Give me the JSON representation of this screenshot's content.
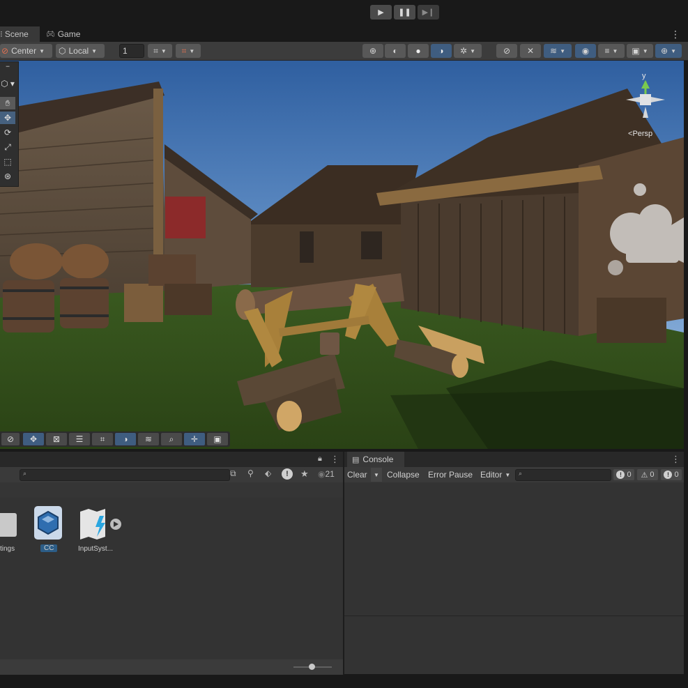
{
  "toolbar_play": {
    "play_icon": "play-icon",
    "pause_icon": "pause-icon",
    "step_icon": "step-icon"
  },
  "tabs": [
    {
      "label": "Scene",
      "icon": "scene-icon",
      "active": true
    },
    {
      "label": "Game",
      "icon": "game-controller-icon",
      "active": false
    }
  ],
  "scene_toolbar": {
    "pivot_mode": "Center",
    "pivot_rotation": "Local",
    "grid_increment": "1"
  },
  "gizmo": {
    "axis_y": "y",
    "projection": "Persp"
  },
  "project": {
    "search_placeholder": "",
    "hidden_count": "21",
    "assets": [
      {
        "label": "tings",
        "icon": "folder-icon"
      },
      {
        "label": "CC",
        "icon": "package-icon",
        "selected": true
      },
      {
        "label": "InputSyst...",
        "icon": "input-actions-icon"
      }
    ]
  },
  "console": {
    "tab_label": "Console",
    "clear": "Clear",
    "collapse": "Collapse",
    "error_pause": "Error Pause",
    "editor": "Editor",
    "log_count": "0",
    "warning_count": "0",
    "error_count": "0"
  },
  "colors": {
    "accent_blue": "#3f5d80",
    "selected_asset": "#2c5d87",
    "panel": "#333333"
  }
}
